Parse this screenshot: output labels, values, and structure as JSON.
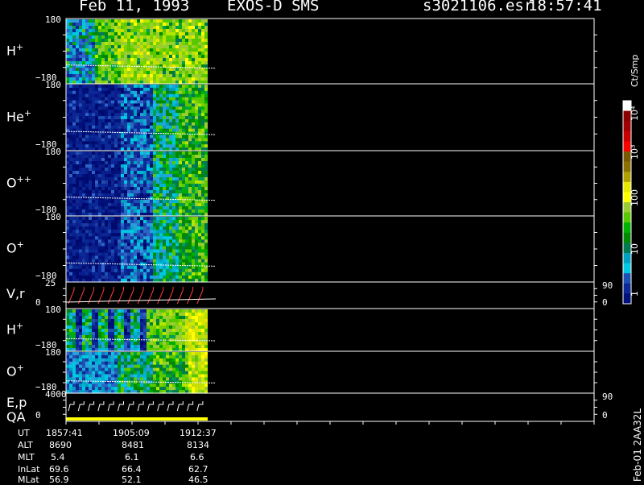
{
  "header": {
    "date": "Feb 11, 1993",
    "instrument": "EXOS-D SMS",
    "file": "s3021106.esr",
    "time": "18:57:41"
  },
  "panels": [
    {
      "label": "H",
      "sup": "+",
      "ymax": "180",
      "ymin": "−180"
    },
    {
      "label": "He",
      "sup": "+",
      "ymax": "180",
      "ymin": "−180"
    },
    {
      "label": "O",
      "sup": "++",
      "ymax": "180",
      "ymin": "−180"
    },
    {
      "label": "O",
      "sup": "+",
      "ymax": "180",
      "ymin": "−180"
    },
    {
      "label": "V,r",
      "sup": "",
      "ymax": "25",
      "ymin": "0",
      "rmax": "90",
      "rmin": "0"
    },
    {
      "label": "H",
      "sup": "+",
      "ymax": "180",
      "ymin": "−180"
    },
    {
      "label": "O",
      "sup": "+",
      "ymax": "180",
      "ymin": "−180"
    },
    {
      "label": "E,p",
      "label2": "QA",
      "sup": "",
      "ymax": "4000",
      "ymin": "0",
      "rmax": "90",
      "rmin": "0"
    }
  ],
  "colorbar": {
    "unit": "Ct/Smp",
    "ticks": [
      "10⁴",
      "10³",
      "100",
      "10",
      "1"
    ],
    "colors": [
      "#ffffff",
      "#8b0000",
      "#a00000",
      "#c80000",
      "#ff0000",
      "#7a5a00",
      "#8a7000",
      "#b0a000",
      "#e8e800",
      "#ffff00",
      "#9acd32",
      "#5ac800",
      "#00b000",
      "#008a00",
      "#007a50",
      "#00a0c0",
      "#00c8e0",
      "#1e50b4",
      "#0a2896",
      "#00127a"
    ]
  },
  "footer": {
    "label": "Feb-01  2AA32L",
    "rows": [
      {
        "name": "UT",
        "values": [
          "1857:41",
          "1905:09",
          "1912:37"
        ]
      },
      {
        "name": "ALT",
        "values": [
          "8690",
          "8481",
          "8134"
        ]
      },
      {
        "name": "MLT",
        "values": [
          "5.4",
          "6.1",
          "6.6"
        ]
      },
      {
        "name": "InLat",
        "values": [
          "69.6",
          "66.4",
          "62.7"
        ]
      },
      {
        "name": "MLat",
        "values": [
          "56.9",
          "52.1",
          "46.5"
        ]
      }
    ]
  },
  "chart_data": {
    "type": "heatmap",
    "title": "Feb 11, 1993   EXOS-D SMS",
    "x_ticks": [
      "1857:41",
      "1905:09",
      "1912:37"
    ],
    "series": [
      {
        "name": "H+",
        "ylim": [
          -180,
          180
        ]
      },
      {
        "name": "He+",
        "ylim": [
          -180,
          180
        ]
      },
      {
        "name": "O++",
        "ylim": [
          -180,
          180
        ]
      },
      {
        "name": "O+",
        "ylim": [
          -180,
          180
        ]
      },
      {
        "name": "V,r",
        "ylim": [
          0,
          25
        ],
        "y2lim": [
          0,
          90
        ]
      },
      {
        "name": "H+",
        "ylim": [
          -180,
          180
        ]
      },
      {
        "name": "O+",
        "ylim": [
          -180,
          180
        ]
      },
      {
        "name": "E,p QA",
        "ylim": [
          0,
          4000
        ],
        "y2lim": [
          0,
          90
        ]
      }
    ],
    "color_scale": {
      "label": "Ct/Smp",
      "log": true,
      "range": [
        1,
        10000
      ]
    }
  }
}
